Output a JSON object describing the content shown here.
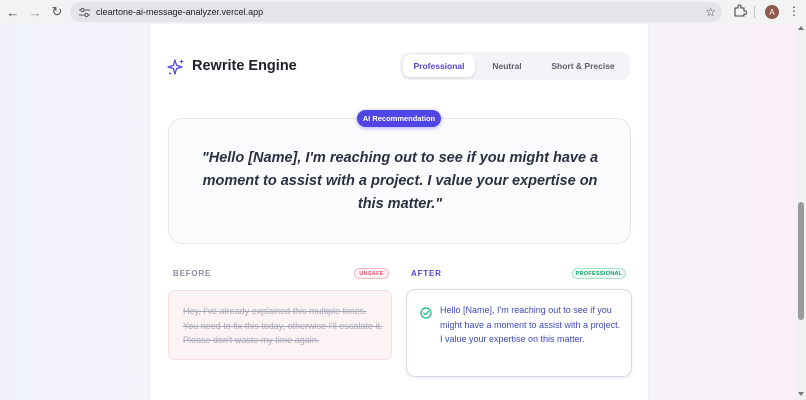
{
  "browser": {
    "url": "cleartone-ai-message-analyzer.vercel.app",
    "avatar_letter": "A",
    "icons": [
      "back-icon",
      "forward-icon",
      "reload-icon",
      "tune-icon",
      "star-icon",
      "extensions-icon",
      "menu-icon"
    ]
  },
  "header": {
    "title": "Rewrite Engine",
    "icon": "sparkles-icon"
  },
  "tabs": [
    {
      "label": "Professional",
      "active": true
    },
    {
      "label": "Neutral",
      "active": false
    },
    {
      "label": "Short & Precise",
      "active": false
    }
  ],
  "recommendation": {
    "badge": "AI Recommendation",
    "text": "\"Hello [Name], I'm reaching out to see if you might have a moment to assist with a project. I value your expertise on this matter.\""
  },
  "before": {
    "label": "BEFORE",
    "badge": "UNSAFE",
    "text": "Hey, I've already explained this multiple times. You need to fix this today, otherwise I'll escalate it. Please don't waste my time again."
  },
  "after": {
    "label": "AFTER",
    "badge": "PROFESSIONAL",
    "text": "Hello [Name], I'm reaching out to see if you might have a moment to assist with a project. I value your expertise on this matter."
  },
  "colors": {
    "accent": "#4f46e5",
    "unsafe": "#e0546a",
    "professional": "#0f9c5e"
  }
}
